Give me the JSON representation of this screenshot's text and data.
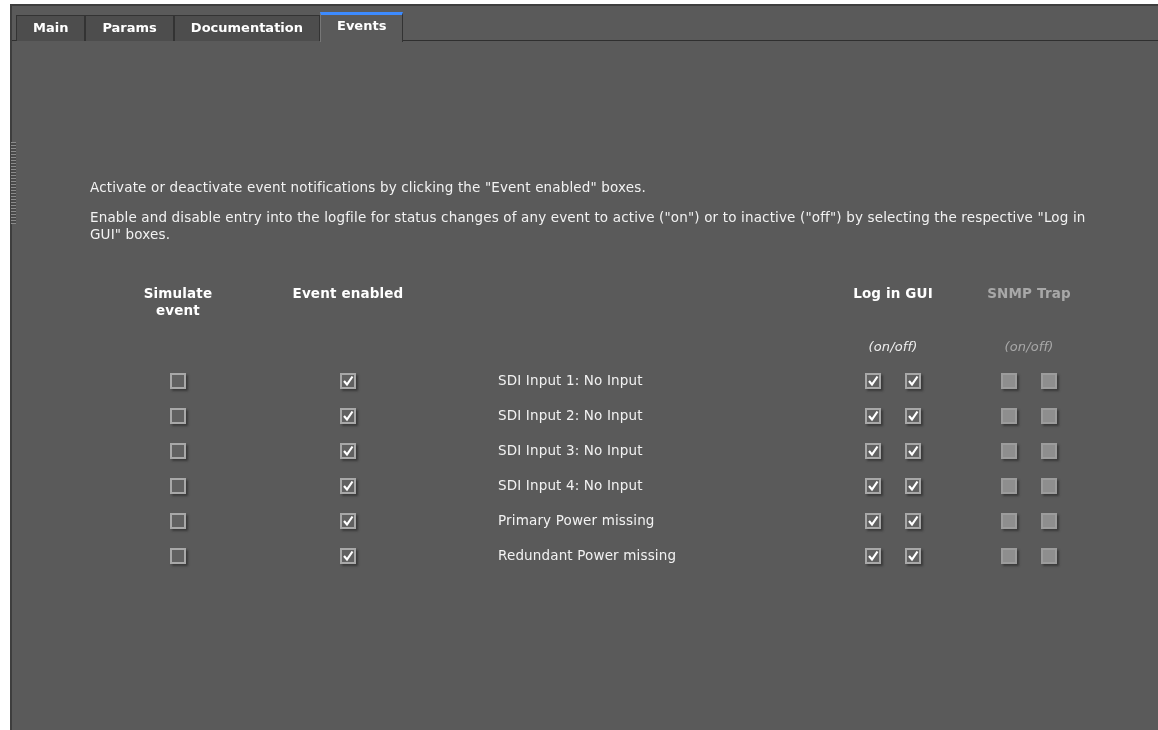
{
  "tabs": [
    {
      "label": "Main",
      "selected": false
    },
    {
      "label": "Params",
      "selected": false
    },
    {
      "label": "Documentation",
      "selected": false
    },
    {
      "label": "Events",
      "selected": true
    }
  ],
  "instructions": [
    "Activate or deactivate event notifications by clicking the \"Event enabled\" boxes.",
    "Enable and disable entry into the logfile for status changes of any event to active (\"on\") or to inactive (\"off\") by selecting the respective \"Log in GUI\" boxes."
  ],
  "columns": {
    "simulate": "Simulate event",
    "enabled": "Event enabled",
    "log": {
      "label": "Log in GUI",
      "hint": "(on/off)",
      "disabled": false
    },
    "snmp": {
      "label": "SNMP Trap",
      "hint": "(on/off)",
      "disabled": true
    }
  },
  "events": [
    {
      "name": "SDI Input 1: No Input",
      "simulate": false,
      "enabled": true,
      "log_on": true,
      "log_off": true,
      "snmp_on": false,
      "snmp_off": false
    },
    {
      "name": "SDI Input 2: No Input",
      "simulate": false,
      "enabled": true,
      "log_on": true,
      "log_off": true,
      "snmp_on": false,
      "snmp_off": false
    },
    {
      "name": "SDI Input 3: No Input",
      "simulate": false,
      "enabled": true,
      "log_on": true,
      "log_off": true,
      "snmp_on": false,
      "snmp_off": false
    },
    {
      "name": "SDI Input 4: No Input",
      "simulate": false,
      "enabled": true,
      "log_on": true,
      "log_off": true,
      "snmp_on": false,
      "snmp_off": false
    },
    {
      "name": "Primary Power missing",
      "simulate": false,
      "enabled": true,
      "log_on": true,
      "log_off": true,
      "snmp_on": false,
      "snmp_off": false
    },
    {
      "name": "Redundant Power missing",
      "simulate": false,
      "enabled": true,
      "log_on": true,
      "log_off": true,
      "snmp_on": false,
      "snmp_off": false
    }
  ]
}
